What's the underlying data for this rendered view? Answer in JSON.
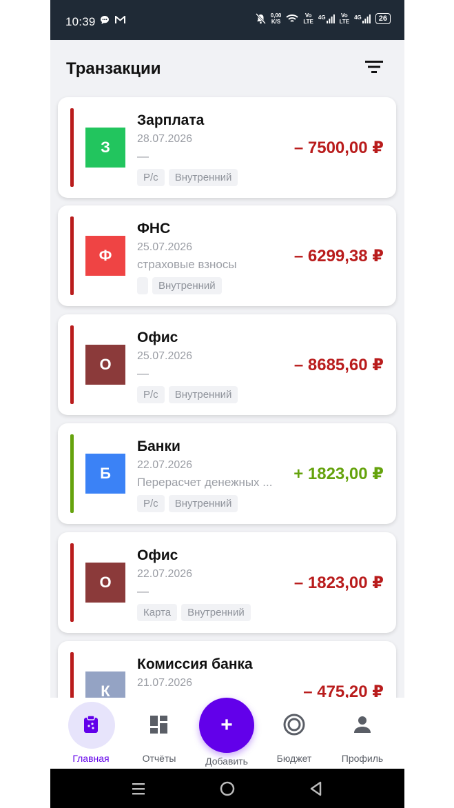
{
  "status_bar": {
    "time": "10:39",
    "speed_top": "0,00",
    "speed_bottom": "K/S",
    "net1_top": "Vo",
    "net1_bottom": "LTE",
    "net1_gen": "4G",
    "net2_top": "Vo",
    "net2_bottom": "LTE",
    "net2_gen": "4G",
    "battery": "26"
  },
  "header": {
    "title": "Транзакции"
  },
  "transactions": [
    {
      "avatar": "З",
      "name": "Зарплата",
      "date": "28.07.2026",
      "description": "—",
      "tags": [
        "Р/с",
        "Внутренний"
      ],
      "amount": "– 7500,00 ₽",
      "avatar_color": "#22c55e",
      "stripe_color": "#b91c1c",
      "amount_color": "#b91c1c"
    },
    {
      "avatar": "Ф",
      "name": "ФНС",
      "date": "25.07.2026",
      "description": "страховые взносы",
      "tags": [
        "",
        "Внутренний"
      ],
      "amount": "– 6299,38 ₽",
      "avatar_color": "#ef4444",
      "stripe_color": "#b91c1c",
      "amount_color": "#b91c1c"
    },
    {
      "avatar": "О",
      "name": "Офис",
      "date": "25.07.2026",
      "description": "—",
      "tags": [
        "Р/с",
        "Внутренний"
      ],
      "amount": "– 8685,60 ₽",
      "avatar_color": "#8b3a3a",
      "stripe_color": "#b91c1c",
      "amount_color": "#b91c1c"
    },
    {
      "avatar": "Б",
      "name": "Банки",
      "date": "22.07.2026",
      "description": "Перерасчет денежных ...",
      "tags": [
        "Р/с",
        "Внутренний"
      ],
      "amount": "+ 1823,00 ₽",
      "avatar_color": "#3b82f6",
      "stripe_color": "#65a30d",
      "amount_color": "#65a30d"
    },
    {
      "avatar": "О",
      "name": "Офис",
      "date": "22.07.2026",
      "description": "—",
      "tags": [
        "Карта",
        "Внутренний"
      ],
      "amount": "– 1823,00 ₽",
      "avatar_color": "#8b3a3a",
      "stripe_color": "#b91c1c",
      "amount_color": "#b91c1c"
    },
    {
      "avatar": "К",
      "name": "Комиссия банка",
      "date": "21.07.2026",
      "description": "",
      "tags": [],
      "amount": "– 475,20 ₽",
      "avatar_color": "#94a3c4",
      "stripe_color": "#b91c1c",
      "amount_color": "#b91c1c"
    }
  ],
  "bottom_nav": {
    "home": "Главная",
    "reports": "Отчёты",
    "add": "Добавить",
    "add_symbol": "+",
    "budget": "Бюджет",
    "profile": "Профиль"
  },
  "colors": {
    "accent": "#6200ea",
    "expense": "#b91c1c",
    "income": "#65a30d"
  }
}
